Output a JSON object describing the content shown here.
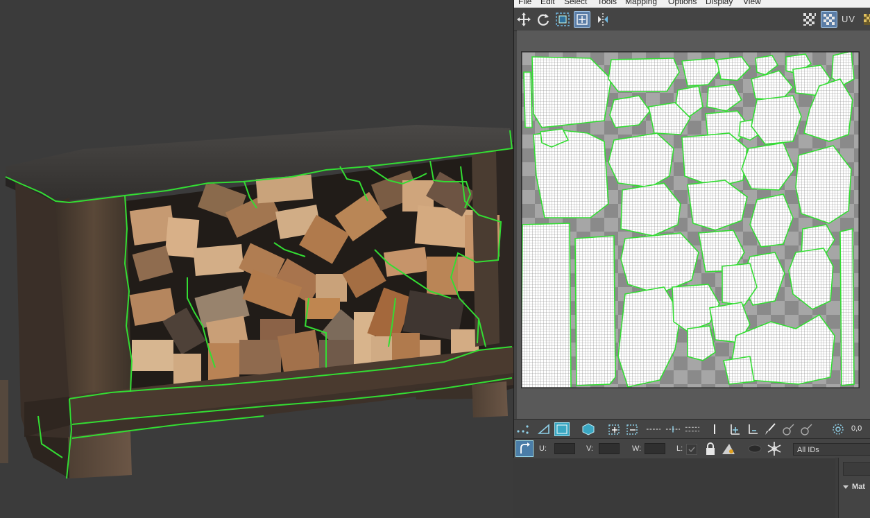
{
  "menu": {
    "items": [
      "File",
      "Edit",
      "Select",
      "Tools",
      "Mapping",
      "Options",
      "Display",
      "View"
    ]
  },
  "uv_editor": {
    "toolbar_label": "UV",
    "coords": {
      "u_label": "U:",
      "v_label": "V:",
      "w_label": "W:",
      "l_label": "L:"
    },
    "value_readout": "0,0",
    "ids_select": "All IDs"
  },
  "side_panel": {
    "rollout_title": "Mat"
  },
  "icons": [
    "move-icon",
    "rotate-icon",
    "scale-icon",
    "freeform-icon",
    "mirror-icon",
    "checker-icon",
    "checker-map-icon",
    "vertex-icon",
    "edge-icon",
    "face-icon",
    "element-icon",
    "grow-icon",
    "shrink-icon",
    "ring-icon",
    "loop-icon",
    "paint-icon",
    "lock-icon",
    "hide-icon",
    "freeze-icon",
    "soft-select-icon"
  ],
  "colors": {
    "seam": "#33dd33",
    "viewport_bg": "#3b3b3b",
    "uv_active": "#3aa7c2"
  }
}
